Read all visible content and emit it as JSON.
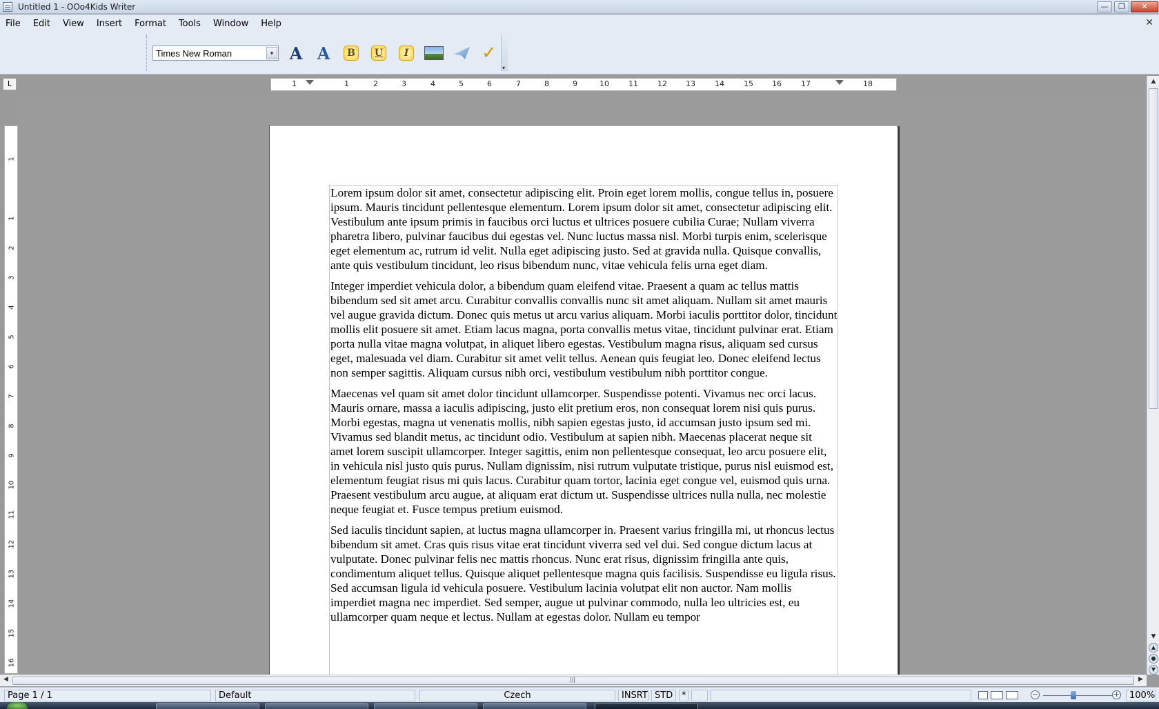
{
  "window": {
    "title": "Untitled 1 - OOo4Kids Writer",
    "controls": {
      "minimize": "—",
      "restore": "❐",
      "close": "✕"
    }
  },
  "menubar": {
    "items": [
      "File",
      "Edit",
      "View",
      "Insert",
      "Format",
      "Tools",
      "Window",
      "Help"
    ],
    "close_doc": "✕"
  },
  "toolbar": {
    "font_name": "Times New Roman",
    "font_dropdown_glyph": "▾",
    "buttons": [
      {
        "name": "character-format-icon",
        "glyph": "A"
      },
      {
        "name": "fontwork-icon",
        "glyph": "A"
      },
      {
        "name": "bold-icon",
        "glyph": "B"
      },
      {
        "name": "underline-icon",
        "glyph": "U"
      },
      {
        "name": "italic-icon",
        "glyph": "I"
      },
      {
        "name": "insert-image-icon",
        "glyph": ""
      },
      {
        "name": "gallery-icon",
        "glyph": ""
      },
      {
        "name": "spellcheck-icon",
        "glyph": "✓"
      }
    ]
  },
  "ruler": {
    "corner_glyph": "L",
    "h_ticks": [
      "1",
      "1",
      "2",
      "3",
      "4",
      "5",
      "6",
      "7",
      "8",
      "9",
      "10",
      "11",
      "12",
      "13",
      "14",
      "15",
      "16",
      "17",
      "18"
    ],
    "v_ticks": [
      "1",
      "1",
      "2",
      "3",
      "4",
      "5",
      "6",
      "7",
      "8",
      "9",
      "10",
      "11",
      "12",
      "13",
      "14",
      "15",
      "16"
    ]
  },
  "document": {
    "paragraphs": [
      "Lorem ipsum dolor sit amet, consectetur adipiscing elit. Proin eget lorem mollis, congue tellus in, posuere ipsum. Mauris tincidunt pellentesque elementum. Lorem ipsum dolor sit amet, consectetur adipiscing elit. Vestibulum ante ipsum primis in faucibus orci luctus et ultrices posuere cubilia Curae; Nullam viverra pharetra libero, pulvinar faucibus dui egestas vel. Nunc luctus massa nisl. Morbi turpis enim, scelerisque eget elementum ac, rutrum id velit. Nulla eget adipiscing justo. Sed at gravida nulla. Quisque convallis, ante quis vestibulum tincidunt, leo risus bibendum nunc, vitae vehicula felis urna eget diam.",
      "Integer imperdiet vehicula dolor, a bibendum quam eleifend vitae. Praesent a quam ac tellus mattis bibendum sed sit amet arcu. Curabitur convallis convallis nunc sit amet aliquam. Nullam sit amet mauris vel augue gravida dictum. Donec quis metus ut arcu varius aliquam. Morbi iaculis porttitor dolor, tincidunt mollis elit posuere sit amet. Etiam lacus magna, porta convallis metus vitae, tincidunt pulvinar erat. Etiam porta nulla vitae magna volutpat, in aliquet libero egestas. Vestibulum magna risus, aliquam sed cursus eget, malesuada vel diam. Curabitur sit amet velit tellus. Aenean quis feugiat leo. Donec eleifend lectus non semper sagittis. Aliquam cursus nibh orci, vestibulum vestibulum nibh porttitor congue.",
      "Maecenas vel quam sit amet dolor tincidunt ullamcorper. Suspendisse potenti. Vivamus nec orci lacus. Mauris ornare, massa a iaculis adipiscing, justo elit pretium eros, non consequat lorem nisi quis purus. Morbi egestas, magna ut venenatis mollis, nibh sapien egestas justo, id accumsan justo ipsum sed mi. Vivamus sed blandit metus, ac tincidunt odio. Vestibulum at sapien nibh. Maecenas placerat neque sit amet lorem suscipit ullamcorper. Integer sagittis, enim non pellentesque consequat, leo arcu posuere elit, in vehicula nisl justo quis purus. Nullam dignissim, nisi rutrum vulputate tristique, purus nisl euismod est, elementum feugiat risus mi quis lacus. Curabitur quam tortor, lacinia eget congue vel, euismod quis urna. Praesent vestibulum arcu augue, at aliquam erat dictum ut. Suspendisse ultrices nulla nulla, nec molestie neque feugiat et. Fusce tempus pretium euismod.",
      "Sed iaculis tincidunt sapien, at luctus magna ullamcorper in. Praesent varius fringilla mi, ut rhoncus lectus bibendum sit amet. Cras quis risus vitae erat tincidunt viverra sed vel dui. Sed congue dictum lacus at vulputate. Donec pulvinar felis nec mattis rhoncus. Nunc erat risus, dignissim fringilla ante quis, condimentum aliquet tellus. Quisque aliquet pellentesque magna quis facilisis. Suspendisse eu ligula risus. Sed accumsan ligula id vehicula posuere. Vestibulum lacinia volutpat elit non auctor. Nam mollis imperdiet magna nec imperdiet. Sed semper, augue ut pulvinar commodo, nulla leo ultricies est, eu ullamcorper quam neque et lectus. Nullam at egestas dolor. Nullam eu tempor"
    ]
  },
  "statusbar": {
    "page": "Page 1 / 1",
    "style": "Default",
    "language": "Czech",
    "insert_mode": "INSRT",
    "selection_mode": "STD",
    "modified": "*",
    "zoom": "100%",
    "zoom_minus": "−",
    "zoom_plus": "+"
  },
  "scrollbars": {
    "up": "▲",
    "down": "▼",
    "left": "◀",
    "right": "▶",
    "grip": "|||",
    "prev_page": "▲",
    "navigator": "●",
    "next_page": "▼"
  }
}
